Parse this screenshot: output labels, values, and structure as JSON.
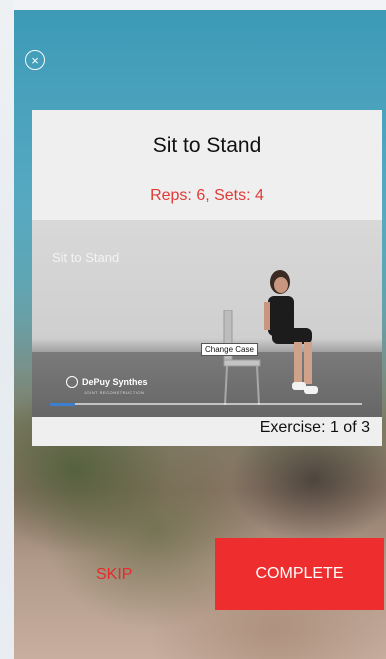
{
  "header": {
    "close_icon": "close-circle-icon"
  },
  "exercise": {
    "title": "Sit to Stand",
    "reps_sets": "Reps: 6, Sets: 4",
    "video_title": "Sit to Stand",
    "change_case_label": "Change Case",
    "logo_text": "DePuy Synthes",
    "logo_subtext": "JOINT RECONSTRUCTION",
    "video_progress_fraction": 0.08,
    "counter": "Exercise: 1 of 3"
  },
  "actions": {
    "skip_label": "SKIP",
    "complete_label": "COMPLETE"
  },
  "colors": {
    "accent_red": "#ee2e2e",
    "reps_red": "#e23a35",
    "progress_blue": "#3f7fd0"
  }
}
